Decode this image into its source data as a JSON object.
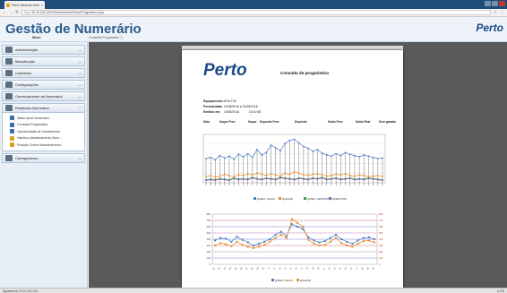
{
  "browser": {
    "tab_title": "Perto Sistema Gerencial",
    "url_scheme": "http://",
    "url": "10.10.100.100/GerenciamentoPerto/Prognostico.aspx"
  },
  "app": {
    "title": "Gestão de Numerário",
    "brand": "Perto",
    "menu_label": "Menu",
    "breadcrumb": "Consulta Prognóstico ⓘ"
  },
  "sidebar": {
    "sections": [
      {
        "label": "Administração",
        "chevron": "⌄"
      },
      {
        "label": "Manutenção",
        "chevron": "⌄"
      },
      {
        "label": "Cadastros",
        "chevron": "⌄"
      },
      {
        "label": "Configurações",
        "chevron": "⌄"
      },
      {
        "label": "Gerenciamento de Numerário",
        "chevron": "⌄"
      },
      {
        "label": "Relatórios Numerário",
        "chevron": "⌃"
      },
      {
        "label": "Carregamento",
        "chevron": "⌄"
      }
    ],
    "report_items": [
      {
        "label": "Saldo Atual Numerário",
        "color": "#3b6ea8"
      },
      {
        "label": "Consulta Prognóstico",
        "color": "#3b6ea8"
      },
      {
        "label": "Oportunidade de Investimento",
        "color": "#3b6ea8"
      },
      {
        "label": "Histórico Abastecimento Num...",
        "color": "#d9a21e"
      },
      {
        "label": "Posição Ordem Abastecimento",
        "color": "#d9a21e"
      }
    ]
  },
  "report": {
    "logo": "Perto",
    "title": "Consulta de prognóstico",
    "equipment_label": "Equipamento:",
    "equipment_value": "ATM-TEZ",
    "period_label": "Período/data:",
    "period_value": "21/08/2018 a 21/08/2018",
    "issued_label": "Emitido em:",
    "issued_value": "10/08/2018",
    "issued_time": "15:10:48",
    "columns": [
      "Data",
      "Saque Prev.",
      "Saque",
      "Depósito Prev.",
      "Depósito",
      "Saldo Prev.",
      "Saldo Real",
      "Dem ganado"
    ]
  },
  "chart_data": [
    {
      "type": "line",
      "series": [
        {
          "name": "@PREV_SALDO",
          "color": "#4a7ec2",
          "values": [
            40,
            42,
            38,
            45,
            41,
            44,
            39,
            47,
            43,
            48,
            42,
            55,
            46,
            50,
            62,
            58,
            53,
            65,
            70,
            72,
            66,
            60,
            57,
            52,
            55,
            49,
            46,
            44,
            48,
            45,
            50,
            47,
            45,
            43,
            46,
            44,
            42,
            40,
            41
          ]
        },
        {
          "name": "@SAQUE",
          "color": "#e88b2a",
          "values": [
            10,
            12,
            9,
            11,
            14,
            12,
            10,
            13,
            12,
            15,
            13,
            16,
            14,
            12,
            15,
            13,
            11,
            16,
            14,
            18,
            16,
            13,
            12,
            14,
            15,
            13,
            11,
            12,
            14,
            13,
            15,
            12,
            11,
            13,
            12,
            10,
            11,
            12,
            10
          ]
        },
        {
          "name": "@PREV_DEPOSITO",
          "color": "#3a9a4a",
          "values": [
            5,
            6,
            5,
            7,
            6,
            5,
            8,
            6,
            7,
            6,
            9,
            7,
            6,
            8,
            7,
            6,
            9,
            8,
            7,
            6,
            8,
            7,
            6,
            8,
            7,
            9,
            6,
            7,
            8,
            6,
            7,
            8,
            6,
            7,
            6,
            8,
            7,
            6,
            5
          ]
        },
        {
          "name": "@DEPOSITO",
          "color": "#8a5ab0",
          "values": [
            4,
            5,
            4,
            6,
            5,
            4,
            7,
            5,
            6,
            5,
            8,
            6,
            5,
            7,
            6,
            5,
            8,
            7,
            6,
            5,
            7,
            6,
            5,
            7,
            6,
            8,
            5,
            6,
            7,
            5,
            6,
            7,
            5,
            6,
            5,
            7,
            6,
            5,
            4
          ]
        }
      ]
    },
    {
      "type": "line",
      "x": [
        "01",
        "02",
        "03",
        "04",
        "05",
        "06",
        "07",
        "08",
        "09",
        "10",
        "11",
        "12",
        "13",
        "14",
        "15",
        "16",
        "17",
        "18",
        "19",
        "20",
        "21",
        "22",
        "23",
        "24",
        "25",
        "26",
        "27",
        "28",
        "29",
        "30"
      ],
      "series": [
        {
          "name": "@PREV_SALDO",
          "color": "#4a7ec2",
          "values": [
            380,
            420,
            410,
            360,
            440,
            390,
            350,
            300,
            330,
            360,
            400,
            470,
            520,
            450,
            640,
            600,
            560,
            430,
            380,
            350,
            370,
            420,
            470,
            400,
            360,
            330,
            380,
            420,
            430,
            400
          ]
        },
        {
          "name": "@SAQUE",
          "color": "#e88b2a",
          "values": [
            300,
            340,
            320,
            290,
            360,
            310,
            280,
            260,
            280,
            310,
            360,
            420,
            470,
            420,
            720,
            660,
            600,
            390,
            330,
            300,
            310,
            360,
            420,
            340,
            300,
            280,
            330,
            370,
            380,
            350
          ]
        }
      ],
      "left_ticks": [
        "800",
        "700",
        "600",
        "500",
        "400",
        "300",
        "200",
        "100",
        "0"
      ],
      "right_ticks": [
        "800",
        "700",
        "600",
        "500",
        "400",
        "300",
        "200",
        "100",
        "0"
      ],
      "ylim": [
        0,
        800
      ]
    }
  ],
  "status": {
    "left": "Aguardando 10.10.100.100...",
    "right": "pt-BR"
  }
}
